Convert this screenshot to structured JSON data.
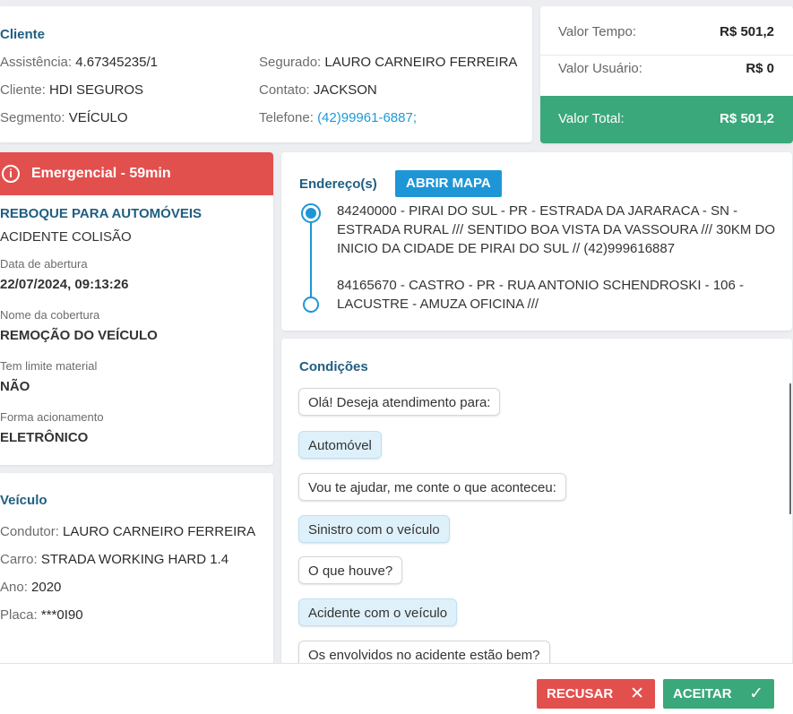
{
  "client": {
    "title": "Cliente",
    "assistencia_label": "Assistência:",
    "assistencia_value": "4.67345235/1",
    "cliente_label": "Cliente:",
    "cliente_value": "HDI SEGUROS",
    "segmento_label": "Segmento:",
    "segmento_value": "VEÍCULO",
    "segurado_label": "Segurado:",
    "segurado_value": "LAURO CARNEIRO FERREIRA",
    "contato_label": "Contato:",
    "contato_value": "JACKSON",
    "telefone_label": "Telefone:",
    "telefone_value": "(42)99961-6887;"
  },
  "values": {
    "tempo_label": "Valor Tempo:",
    "tempo_value": "R$ 501,2",
    "usuario_label": "Valor Usuário:",
    "usuario_value": "R$ 0",
    "total_label": "Valor Total:",
    "total_value": "R$ 501,2",
    "total_color": "#3aa87a"
  },
  "service": {
    "emergency_label": "Emergencial - 59min",
    "emergency_icon": "info-circle-icon",
    "emergency_color": "#e2504e",
    "type": "REBOQUE PARA AUTOMÓVEIS",
    "cause": "ACIDENTE COLISÃO",
    "opened_label": "Data de abertura",
    "opened_value": "22/07/2024, 09:13:26",
    "coverage_label": "Nome da cobertura",
    "coverage_value": "REMOÇÃO DO VEÍCULO",
    "material_label": "Tem limite material",
    "material_value": "NÃO",
    "trigger_label": "Forma acionamento",
    "trigger_value": "ELETRÔNICO"
  },
  "vehicle": {
    "title": "Veículo",
    "driver_label": "Condutor:",
    "driver_value": "LAURO CARNEIRO FERREIRA",
    "car_label": "Carro:",
    "car_value": "STRADA WORKING HARD 1.4",
    "year_label": "Ano:",
    "year_value": "2020",
    "plate_label": "Placa:",
    "plate_value": "***0I90"
  },
  "address": {
    "title": "Endereço(s)",
    "map_button": "ABRIR MAPA",
    "origin": "84240000 - PIRAI DO SUL - PR - ESTRADA DA JARARACA - SN - ESTRADA RURAL /// SENTIDO BOA VISTA DA VASSOURA /// 30KM DO INICIO DA CIDADE DE PIRAI DO SUL // (42)999616887",
    "destination": "84165670 - CASTRO - PR - RUA ANTONIO SCHENDROSKI - 106 - LACUSTRE - AMUZA OFICINA ///"
  },
  "conditions": {
    "title": "Condições",
    "messages": [
      {
        "role": "system",
        "text": "Olá! Deseja atendimento para:"
      },
      {
        "role": "user",
        "text": "Automóvel"
      },
      {
        "role": "system",
        "text": "Vou te ajudar, me conte o que aconteceu:"
      },
      {
        "role": "user",
        "text": "Sinistro com o veículo"
      },
      {
        "role": "system",
        "text": "O que houve?"
      },
      {
        "role": "user",
        "text": "Acidente com o veículo"
      },
      {
        "role": "system",
        "text": "Os envolvidos no acidente estão bem?"
      }
    ]
  },
  "footer": {
    "reject_label": "RECUSAR",
    "reject_icon": "close-icon",
    "accept_label": "ACEITAR",
    "accept_icon": "check-icon"
  }
}
